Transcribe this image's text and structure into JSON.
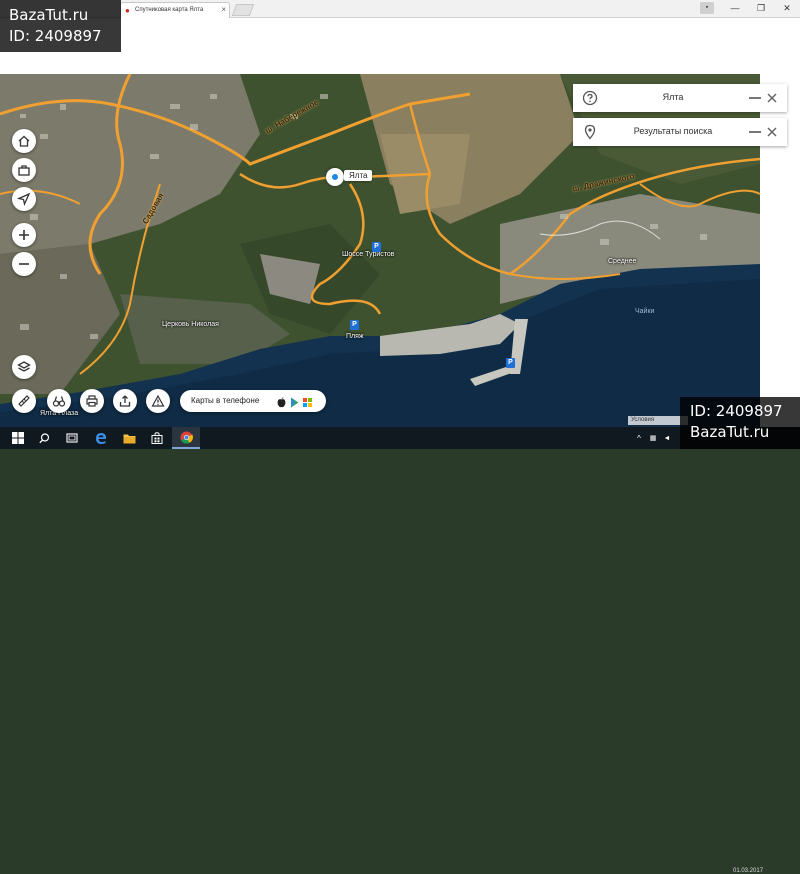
{
  "browser": {
    "tab_title": "Спутниковая карта Ялта",
    "tab_close": "×",
    "win_minimize": "—",
    "win_maximize": "❐",
    "win_close": "✕"
  },
  "watermarks": {
    "site": "BazaTut.ru",
    "id_label": "ID: 2409897"
  },
  "search_panels": [
    {
      "text": "Ялта",
      "icon": "help-icon"
    },
    {
      "text": "Результаты поиска",
      "icon": "location-pin-icon"
    }
  ],
  "marker": {
    "label": "Ялта"
  },
  "map_labels": {
    "road_naberezhnoe": "ш. Набережное",
    "road_drazhinskogo": "ш. Дражинского",
    "road_sadovaya": "Садовая",
    "shosse_turistov": "Шоссе Туристов",
    "tserkov": "Церковь Николая",
    "plyazh": "Пляж",
    "yalta_plaza": "Ялта Плаза",
    "sea": "Чайки",
    "srednee": "Среднее"
  },
  "left_controls": [
    {
      "name": "home-button",
      "icon": "home-icon"
    },
    {
      "name": "briefcase-button",
      "icon": "briefcase-icon"
    },
    {
      "name": "locate-button",
      "icon": "navigation-arrow-icon"
    },
    {
      "name": "zoom-in-button",
      "icon": "plus-icon"
    },
    {
      "name": "zoom-out-button",
      "icon": "minus-icon"
    },
    {
      "name": "layers-button",
      "icon": "layers-icon"
    }
  ],
  "toolbar": {
    "phone_label": "Карты в телефоне",
    "tools": [
      "ruler-icon",
      "binoculars-icon",
      "printer-icon",
      "share-icon",
      "warning-icon"
    ]
  },
  "scale_text": "Условия использования",
  "taskbar": {
    "tray_date": "01.03.2017"
  },
  "colors": {
    "road": "#f0a030",
    "sea": "#12324f",
    "marker": "#1e88e5",
    "watermark_bg": "#000000"
  }
}
